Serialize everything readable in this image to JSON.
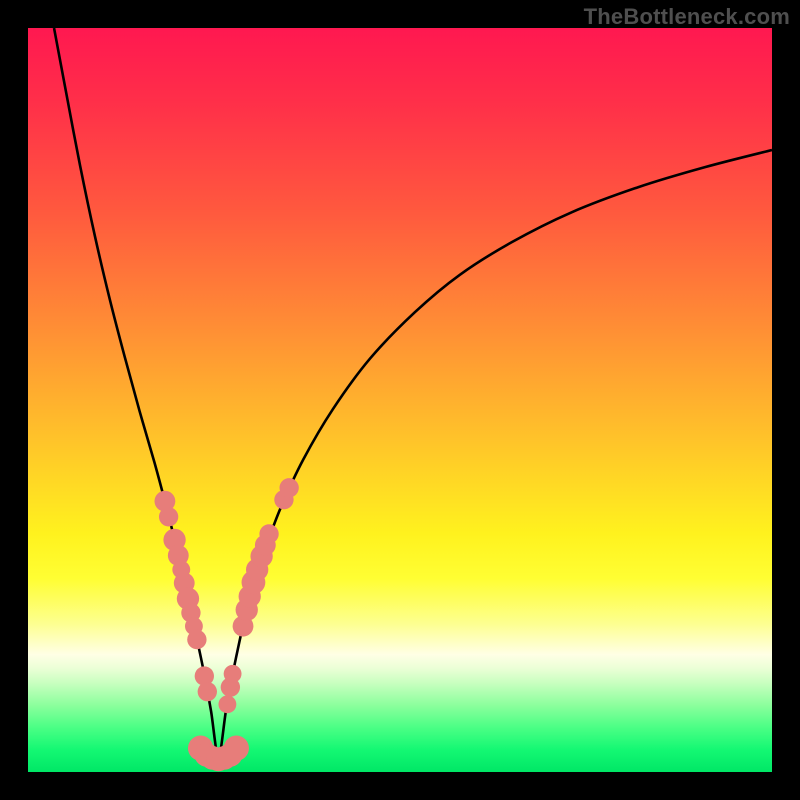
{
  "watermark": "TheBottleneck.com",
  "colors": {
    "frame": "#000000",
    "curve": "#000000",
    "marker_fill": "#e77d7a",
    "gradient_stops": [
      {
        "offset": 0.0,
        "color": "#ff1850"
      },
      {
        "offset": 0.1,
        "color": "#ff2f49"
      },
      {
        "offset": 0.25,
        "color": "#ff5a3e"
      },
      {
        "offset": 0.4,
        "color": "#ff8d35"
      },
      {
        "offset": 0.55,
        "color": "#ffc22a"
      },
      {
        "offset": 0.68,
        "color": "#fff21e"
      },
      {
        "offset": 0.74,
        "color": "#fffe33"
      },
      {
        "offset": 0.8,
        "color": "#fdff8f"
      },
      {
        "offset": 0.842,
        "color": "#ffffe5"
      },
      {
        "offset": 0.86,
        "color": "#ecffd7"
      },
      {
        "offset": 0.88,
        "color": "#c9ffc0"
      },
      {
        "offset": 0.91,
        "color": "#8cff9d"
      },
      {
        "offset": 0.94,
        "color": "#4bff85"
      },
      {
        "offset": 0.97,
        "color": "#14f873"
      },
      {
        "offset": 1.0,
        "color": "#00e766"
      }
    ]
  },
  "chart_data": {
    "type": "line",
    "title": "",
    "xlabel": "",
    "ylabel": "",
    "xlim": [
      0,
      100
    ],
    "ylim": [
      0,
      100
    ],
    "minimum_x": 25.6,
    "series": [
      {
        "name": "bottleneck-curve",
        "x": [
          3.5,
          5,
          7,
          9,
          11,
          13,
          15,
          17,
          18.5,
          20,
          21,
          22,
          23,
          23.8,
          24.6,
          25.6,
          26.6,
          27.4,
          28.2,
          29.2,
          30.4,
          32,
          34,
          37,
          41,
          46,
          52,
          58,
          65,
          73,
          82,
          91,
          100
        ],
        "y": [
          100,
          92,
          81.5,
          72,
          63.5,
          55.8,
          48.5,
          41.6,
          36,
          30,
          25.5,
          21,
          16.5,
          12.6,
          8.2,
          2.1,
          8.2,
          12.6,
          16.5,
          21,
          25.5,
          30.3,
          35.6,
          42.0,
          48.8,
          55.6,
          61.8,
          66.8,
          71.2,
          75.2,
          78.6,
          81.3,
          83.6
        ]
      }
    ],
    "markers": {
      "name": "highlight-clusters",
      "points": [
        {
          "x": 18.4,
          "y": 36.4,
          "r": 1.4
        },
        {
          "x": 18.9,
          "y": 34.3,
          "r": 1.3
        },
        {
          "x": 19.7,
          "y": 31.2,
          "r": 1.5
        },
        {
          "x": 20.2,
          "y": 29.1,
          "r": 1.4
        },
        {
          "x": 20.6,
          "y": 27.2,
          "r": 1.2
        },
        {
          "x": 21.0,
          "y": 25.4,
          "r": 1.4
        },
        {
          "x": 21.5,
          "y": 23.3,
          "r": 1.5
        },
        {
          "x": 21.9,
          "y": 21.4,
          "r": 1.3
        },
        {
          "x": 22.3,
          "y": 19.6,
          "r": 1.2
        },
        {
          "x": 22.7,
          "y": 17.8,
          "r": 1.3
        },
        {
          "x": 23.7,
          "y": 12.9,
          "r": 1.3
        },
        {
          "x": 24.1,
          "y": 10.8,
          "r": 1.3
        },
        {
          "x": 23.2,
          "y": 3.2,
          "r": 1.7
        },
        {
          "x": 24.0,
          "y": 2.3,
          "r": 1.6
        },
        {
          "x": 24.8,
          "y": 1.9,
          "r": 1.6
        },
        {
          "x": 25.6,
          "y": 1.7,
          "r": 1.6
        },
        {
          "x": 26.4,
          "y": 1.9,
          "r": 1.6
        },
        {
          "x": 27.2,
          "y": 2.3,
          "r": 1.6
        },
        {
          "x": 28.0,
          "y": 3.2,
          "r": 1.7
        },
        {
          "x": 26.8,
          "y": 9.1,
          "r": 1.2
        },
        {
          "x": 27.2,
          "y": 11.4,
          "r": 1.3
        },
        {
          "x": 27.5,
          "y": 13.2,
          "r": 1.2
        },
        {
          "x": 28.9,
          "y": 19.6,
          "r": 1.4
        },
        {
          "x": 29.4,
          "y": 21.8,
          "r": 1.5
        },
        {
          "x": 29.8,
          "y": 23.6,
          "r": 1.5
        },
        {
          "x": 30.3,
          "y": 25.5,
          "r": 1.6
        },
        {
          "x": 30.8,
          "y": 27.2,
          "r": 1.5
        },
        {
          "x": 31.4,
          "y": 29.0,
          "r": 1.5
        },
        {
          "x": 31.9,
          "y": 30.5,
          "r": 1.4
        },
        {
          "x": 32.4,
          "y": 32.0,
          "r": 1.3
        },
        {
          "x": 34.4,
          "y": 36.6,
          "r": 1.3
        },
        {
          "x": 35.1,
          "y": 38.2,
          "r": 1.3
        }
      ]
    }
  }
}
